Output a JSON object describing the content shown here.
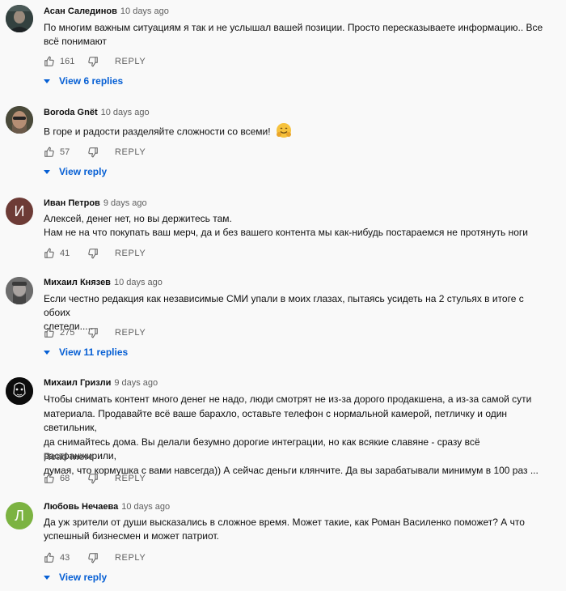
{
  "comments": [
    {
      "author": "Асан Салединов",
      "time": "10 days ago",
      "lines": [
        "По многим важным ситуациям я так и не услышал вашей позиции. Просто пересказываете информацию.. Все",
        "всё понимают"
      ],
      "likes": "161",
      "reply_label": "REPLY",
      "replies_label": "View 6 replies"
    },
    {
      "author": "Boroda Gnёt",
      "time": "10 days ago",
      "lines": [
        "В горе и радости разделяйте сложности со всеми!"
      ],
      "emoji": "hugging-face-emoji",
      "likes": "57",
      "reply_label": "REPLY",
      "replies_label": "View reply"
    },
    {
      "author": "Иван Петров",
      "time": "9 days ago",
      "avatar_letter": "И",
      "avatar_color": "#6d3b36",
      "lines": [
        "Алексей, денег нет, но вы держитесь там.",
        "Нам не на что покупать ваш мерч, да и без вашего контента мы как-нибудь постараемся не протянуть ноги"
      ],
      "likes": "41",
      "reply_label": "REPLY"
    },
    {
      "author": "Михаил Князев",
      "time": "10 days ago",
      "lines": [
        "Если честно редакция как независимые СМИ упали в моих глазах, пытаясь усидеть на 2 стульях в итоге с обоих",
        "слетели....."
      ],
      "likes": "275",
      "reply_label": "REPLY",
      "replies_label": "View 11 replies"
    },
    {
      "author": "Михаил Гризли",
      "time": "9 days ago",
      "lines": [
        "Чтобы снимать контент много денег не надо, люди смотрят не из-за дорого продакшена, а из-за самой сути",
        "материала. Продавайте всё ваше барахло, оставьте телефон с нормальной камерой, петличку и один светильник,",
        "да снимайтесь дома. Вы делали безумно дорогие интеграции, но как всякие славяне - сразу всё растранжирили,",
        "думая, что кормушка с вами навсегда)) А сейчас деньги клянчите. Да вы зарабатывали минимум в 100 раз ..."
      ],
      "read_more": "Read more",
      "likes": "68",
      "reply_label": "REPLY"
    },
    {
      "author": "Любовь Нечаева",
      "time": "10 days ago",
      "avatar_letter": "Л",
      "avatar_color": "#7cb342",
      "lines": [
        "Да уж зрители от души высказались в сложное время. Может такие, как Роман Василенко поможет? А что",
        "успешный бизнесмен и может патриот."
      ],
      "likes": "43",
      "reply_label": "REPLY",
      "replies_label": "View reply"
    }
  ]
}
